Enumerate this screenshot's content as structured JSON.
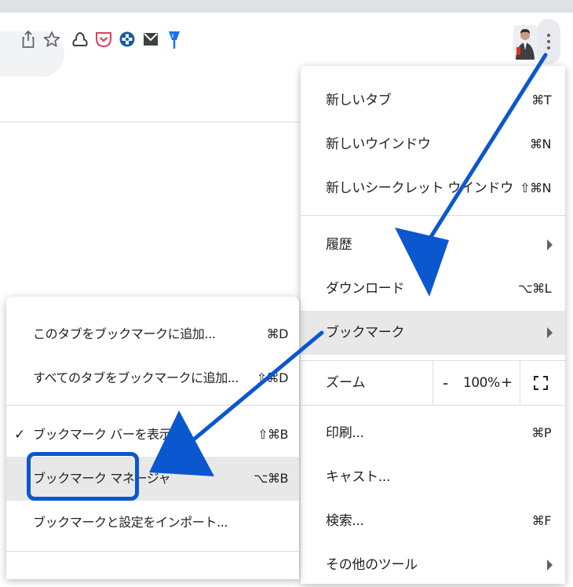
{
  "colors": {
    "accent": "#0b57d0",
    "menu_highlight": "#e8e8e8"
  },
  "toolbar": {
    "icons": [
      "share-icon",
      "star-icon",
      "cloud-extension-icon",
      "pocket-icon",
      "plus-circle-icon",
      "mail-icon",
      "pin-icon"
    ]
  },
  "menu": {
    "new_tab": {
      "label": "新しいタブ",
      "shortcut": "⌘T"
    },
    "new_window": {
      "label": "新しいウインドウ",
      "shortcut": "⌘N"
    },
    "incognito": {
      "label": "新しいシークレット ウインドウ",
      "shortcut": "⇧⌘N"
    },
    "history": {
      "label": "履歴"
    },
    "downloads": {
      "label": "ダウンロード",
      "shortcut": "⌥⌘L"
    },
    "bookmarks": {
      "label": "ブックマーク"
    },
    "zoom": {
      "label": "ズーム",
      "minus": "-",
      "value": "100%",
      "plus": "+"
    },
    "print": {
      "label": "印刷...",
      "shortcut": "⌘P"
    },
    "cast": {
      "label": "キャスト..."
    },
    "find": {
      "label": "検索...",
      "shortcut": "⌘F"
    },
    "more_tools": {
      "label": "その他のツール"
    }
  },
  "submenu": {
    "bookmark_tab": {
      "label": "このタブをブックマークに追加...",
      "shortcut": "⌘D"
    },
    "bookmark_all": {
      "label": "すべてのタブをブックマークに追加...",
      "shortcut": "⇧⌘D"
    },
    "show_bar": {
      "check": "✓",
      "label": "ブックマーク バーを表示",
      "shortcut": "⇧⌘B"
    },
    "manager": {
      "label": "ブックマーク マネージャ",
      "shortcut": "⌥⌘B"
    },
    "import": {
      "label": "ブックマークと設定をインポート..."
    }
  }
}
